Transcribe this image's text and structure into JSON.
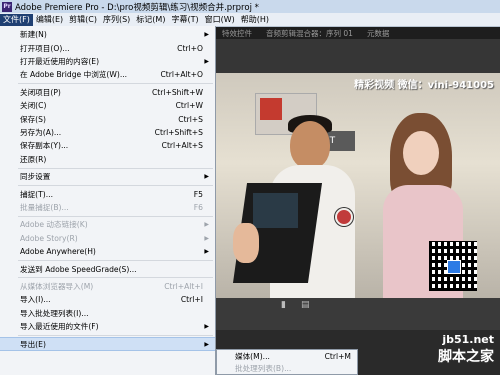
{
  "window": {
    "app_icon_label": "Pr",
    "title": "Adobe Premiere Pro - D:\\pro视频剪辑\\练习\\视频合并.prproj *"
  },
  "menubar": [
    {
      "label": "文件(F)",
      "active": true
    },
    {
      "label": "编辑(E)",
      "active": false
    },
    {
      "label": "剪辑(C)",
      "active": false
    },
    {
      "label": "序列(S)",
      "active": false
    },
    {
      "label": "标记(M)",
      "active": false
    },
    {
      "label": "字幕(T)",
      "active": false
    },
    {
      "label": "窗口(W)",
      "active": false
    },
    {
      "label": "帮助(H)",
      "active": false
    }
  ],
  "panel_tabs": [
    "特效控件",
    "音频剪辑混合器：序列 01",
    "元数据"
  ],
  "file_menu": [
    {
      "label": "新建(N)",
      "shortcut": "",
      "arrow": true,
      "disabled": false
    },
    {
      "label": "打开项目(O)...",
      "shortcut": "Ctrl+O",
      "arrow": false,
      "disabled": false
    },
    {
      "label": "打开最近使用的内容(E)",
      "shortcut": "",
      "arrow": true,
      "disabled": false
    },
    {
      "label": "在 Adobe Bridge 中浏览(W)...",
      "shortcut": "Ctrl+Alt+O",
      "arrow": false,
      "disabled": false
    },
    {
      "sep": true
    },
    {
      "label": "关闭项目(P)",
      "shortcut": "Ctrl+Shift+W",
      "arrow": false,
      "disabled": false
    },
    {
      "label": "关闭(C)",
      "shortcut": "Ctrl+W",
      "arrow": false,
      "disabled": false
    },
    {
      "label": "保存(S)",
      "shortcut": "Ctrl+S",
      "arrow": false,
      "disabled": false
    },
    {
      "label": "另存为(A)...",
      "shortcut": "Ctrl+Shift+S",
      "arrow": false,
      "disabled": false
    },
    {
      "label": "保存副本(Y)...",
      "shortcut": "Ctrl+Alt+S",
      "arrow": false,
      "disabled": false
    },
    {
      "label": "还原(R)",
      "shortcut": "",
      "arrow": false,
      "disabled": false
    },
    {
      "sep": true
    },
    {
      "label": "同步设置",
      "shortcut": "",
      "arrow": true,
      "disabled": false
    },
    {
      "sep": true
    },
    {
      "label": "捕捉(T)...",
      "shortcut": "F5",
      "arrow": false,
      "disabled": false
    },
    {
      "label": "批量捕捉(B)...",
      "shortcut": "F6",
      "arrow": false,
      "disabled": true
    },
    {
      "sep": true
    },
    {
      "label": "Adobe 动态链接(K)",
      "shortcut": "",
      "arrow": true,
      "disabled": true
    },
    {
      "label": "Adobe Story(R)",
      "shortcut": "",
      "arrow": true,
      "disabled": true
    },
    {
      "label": "Adobe Anywhere(H)",
      "shortcut": "",
      "arrow": true,
      "disabled": false
    },
    {
      "sep": true
    },
    {
      "label": "发送到 Adobe SpeedGrade(S)...",
      "shortcut": "",
      "arrow": false,
      "disabled": false
    },
    {
      "sep": true
    },
    {
      "label": "从媒体浏览器导入(M)",
      "shortcut": "Ctrl+Alt+I",
      "arrow": false,
      "disabled": true
    },
    {
      "label": "导入(I)...",
      "shortcut": "Ctrl+I",
      "arrow": false,
      "disabled": false
    },
    {
      "label": "导入批处理列表(I)...",
      "shortcut": "",
      "arrow": false,
      "disabled": false
    },
    {
      "label": "导入最近使用的文件(F)",
      "shortcut": "",
      "arrow": true,
      "disabled": false
    },
    {
      "sep": true
    },
    {
      "label": "导出(E)",
      "shortcut": "",
      "arrow": true,
      "disabled": false,
      "highlight": true
    }
  ],
  "export_submenu": [
    {
      "label": "媒体(M)...",
      "shortcut": "Ctrl+M",
      "disabled": false
    },
    {
      "label": "批处理列表(B)...",
      "shortcut": "",
      "disabled": true
    }
  ],
  "video": {
    "watermark": "精彩视频 微信：vini-941005",
    "store_sign": "J&T"
  },
  "site_watermark": {
    "domain": "jb51.net",
    "name": "脚本之家"
  }
}
